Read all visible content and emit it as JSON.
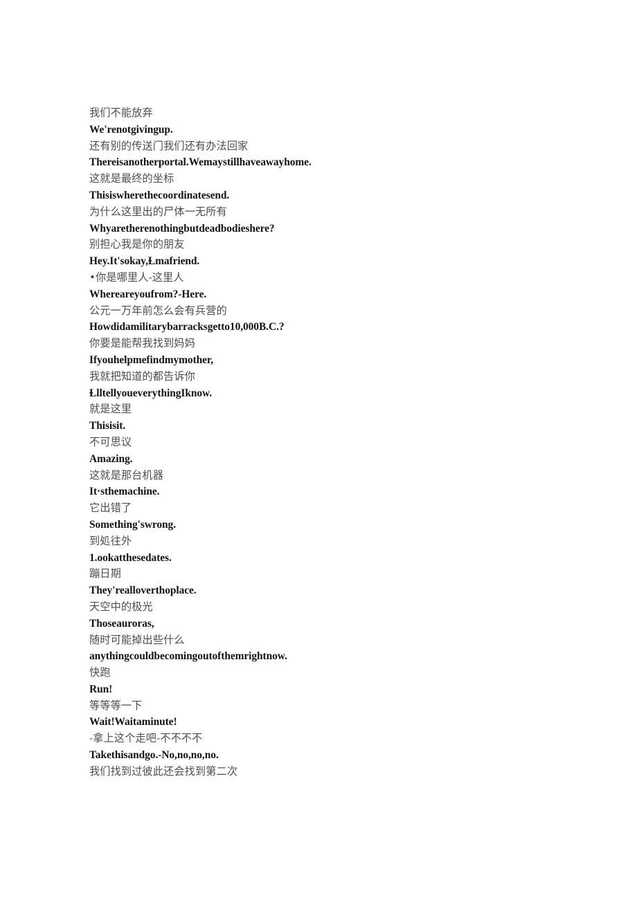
{
  "document": {
    "background_color": "#ffffff",
    "zh_text_color": "#4d4d4d",
    "en_text_color": "#141414",
    "lines": [
      {
        "lang": "zh",
        "text": "我们不能放弃"
      },
      {
        "lang": "en",
        "text": "We'renotgivingup."
      },
      {
        "lang": "zh",
        "text": "还有别的传送门我们还有办法回家"
      },
      {
        "lang": "en",
        "text": "Thereisanotherportal.Wemaystillhaveawayhome."
      },
      {
        "lang": "zh",
        "text": "这就是最终的坐标"
      },
      {
        "lang": "en",
        "text": "Thisiswherethecoordinatesend."
      },
      {
        "lang": "zh",
        "text": "为什么这里出的尸体一无所有"
      },
      {
        "lang": "en",
        "text": "Whyaretherenothingbutdeadbodieshere?"
      },
      {
        "lang": "zh",
        "text": "别担心我是你的朋友"
      },
      {
        "lang": "en",
        "text": "Hey.It'sokay,Ɫmafriend."
      },
      {
        "lang": "zh",
        "text": "•你是哪里人-这里人"
      },
      {
        "lang": "en",
        "text": "Whereareyoufrom?-Here."
      },
      {
        "lang": "zh",
        "text": "公元一万年前怎么会有兵营的"
      },
      {
        "lang": "en",
        "text": "Howdidamilitarybarracksgetto10,000B.C.?"
      },
      {
        "lang": "zh",
        "text": "你要是能帮我找到妈妈"
      },
      {
        "lang": "en",
        "text": "Ifyouhelpmefindmymother,"
      },
      {
        "lang": "zh",
        "text": "我就把知道的都告诉你"
      },
      {
        "lang": "en",
        "text": "ⱢlltellyoueverythingIknow."
      },
      {
        "lang": "zh",
        "text": "就是这里"
      },
      {
        "lang": "en",
        "text": "Thisisit."
      },
      {
        "lang": "zh",
        "text": "不可思议"
      },
      {
        "lang": "en",
        "text": "Amazing."
      },
      {
        "lang": "zh",
        "text": "这就是那台机器"
      },
      {
        "lang": "en",
        "text": "It·sthemachine."
      },
      {
        "lang": "zh",
        "text": "它出错了"
      },
      {
        "lang": "en",
        "text": "Something'swrong."
      },
      {
        "lang": "zh",
        "text": "到処往外"
      },
      {
        "lang": "en",
        "text": "1.ookatthesedates."
      },
      {
        "lang": "zh",
        "text": "蹦日期"
      },
      {
        "lang": "en",
        "text": "They'realloverthoplace."
      },
      {
        "lang": "zh",
        "text": "天空中的极光"
      },
      {
        "lang": "en",
        "text": "Thoseauroras,"
      },
      {
        "lang": "zh",
        "text": "随时可能掉出些什么"
      },
      {
        "lang": "en",
        "text": "anythingcouldbecomingoutofthemrightnow."
      },
      {
        "lang": "zh",
        "text": "快跑"
      },
      {
        "lang": "en",
        "text": "Run!"
      },
      {
        "lang": "zh",
        "text": "等等等一下"
      },
      {
        "lang": "en",
        "text": "Wait!Waitaminute!"
      },
      {
        "lang": "zh",
        "text": "-拿上这个走吧-不不不不"
      },
      {
        "lang": "en",
        "text": "Takethisandgo.-No,no,no,no."
      },
      {
        "lang": "zh",
        "text": "我们找到过彼此还会找到第二次"
      }
    ]
  }
}
